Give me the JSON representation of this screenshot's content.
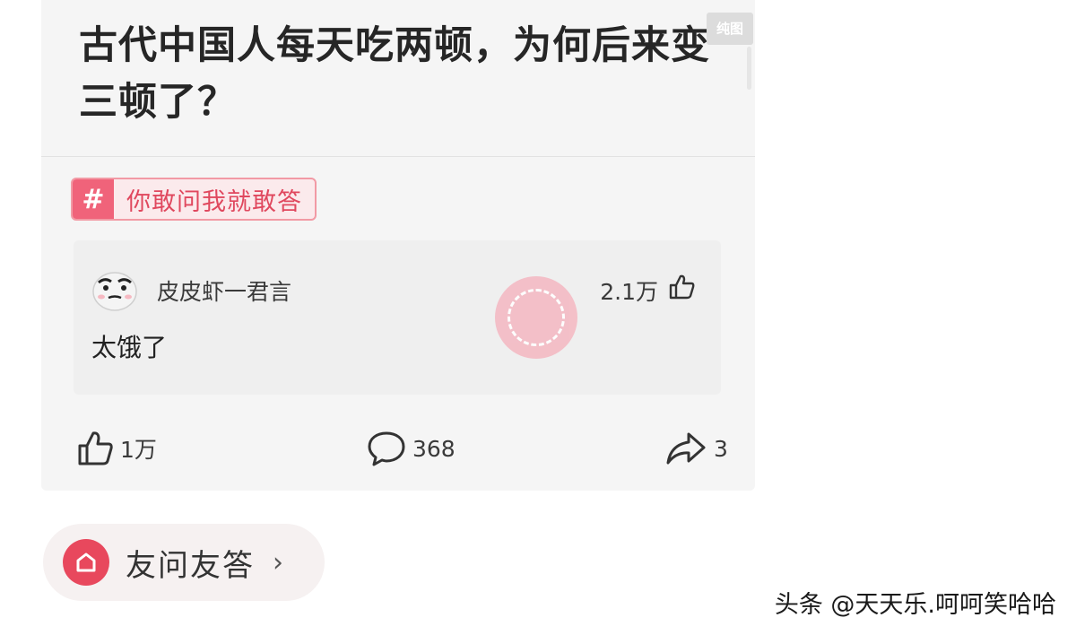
{
  "question": {
    "title": "古代中国人每天吃两顿，为何后来变三顿了？",
    "corner_tag": "纯图"
  },
  "topic": {
    "hash": "#",
    "label": "你敢问我就敢答"
  },
  "top_answer": {
    "author": "皮皮虾一君言",
    "likes": "2.1万",
    "text": "太饿了",
    "avatar_icon": "cartoon-face-icon",
    "stamp_icon": "pink-stamp-icon"
  },
  "actions": {
    "like_count": "1万",
    "comment_count": "368",
    "share_count": "3"
  },
  "entry": {
    "label": "友问友答",
    "chevron": "›",
    "icon": "home-icon"
  },
  "watermark": {
    "text": "头条 @天天乐.呵呵笑哈哈"
  },
  "colors": {
    "accent": "#e8485d",
    "topic_bg": "#fbeaec",
    "card_bg": "#f5f5f5"
  }
}
